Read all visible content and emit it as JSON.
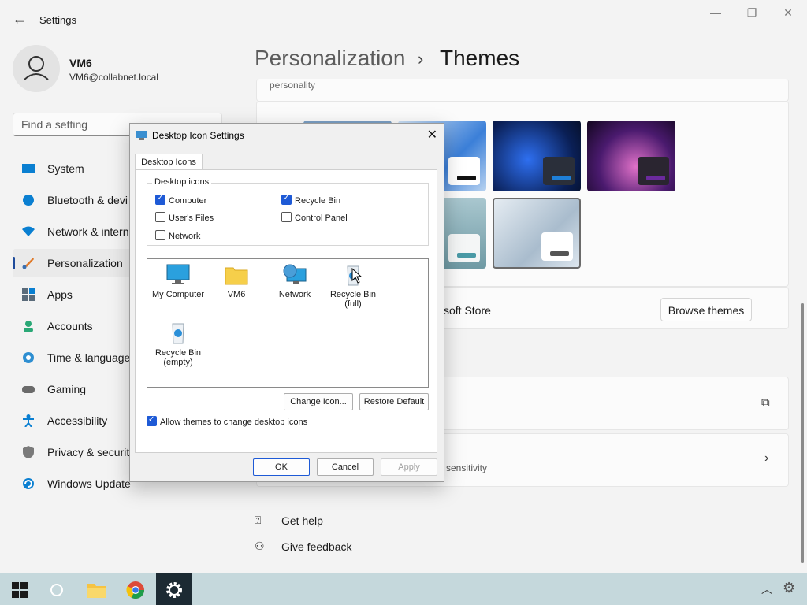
{
  "window": {
    "title": "Settings"
  },
  "profile": {
    "name": "VM6",
    "email": "VM6@collabnet.local"
  },
  "search": {
    "placeholder": "Find a setting"
  },
  "nav": {
    "items": [
      {
        "label": "System"
      },
      {
        "label": "Bluetooth & devi"
      },
      {
        "label": "Network & intern"
      },
      {
        "label": "Personalization"
      },
      {
        "label": "Apps"
      },
      {
        "label": "Accounts"
      },
      {
        "label": "Time & language"
      },
      {
        "label": "Gaming"
      },
      {
        "label": "Accessibility"
      },
      {
        "label": "Privacy & security"
      },
      {
        "label": "Windows Update"
      }
    ]
  },
  "header": {
    "parent": "Personalization",
    "separator": "›",
    "current": "Themes"
  },
  "content": {
    "personality_text": "personality",
    "store_text": "soft Store",
    "browse_themes": "Browse themes",
    "sensitivity_text": "sensitivity",
    "get_help": "Get help",
    "give_feedback": "Give feedback"
  },
  "dialog": {
    "title": "Desktop Icon Settings",
    "tab": "Desktop Icons",
    "group_label": "Desktop icons",
    "checkboxes": [
      {
        "label": "Computer"
      },
      {
        "label": "Recycle Bin"
      },
      {
        "label": "User's Files"
      },
      {
        "label": "Control Panel"
      },
      {
        "label": "Network"
      }
    ],
    "icons": [
      {
        "label": "My Computer"
      },
      {
        "label": "VM6"
      },
      {
        "label": "Network"
      },
      {
        "label": "Recycle Bin (full)"
      },
      {
        "label": "Recycle Bin (empty)"
      }
    ],
    "change_icon": "Change Icon...",
    "restore_default": "Restore Default",
    "allow_themes": "Allow themes to change desktop icons",
    "ok": "OK",
    "cancel": "Cancel",
    "apply": "Apply"
  },
  "colors": {
    "accent": "#1e5ad6",
    "taskbar": "#c5d8dc"
  }
}
